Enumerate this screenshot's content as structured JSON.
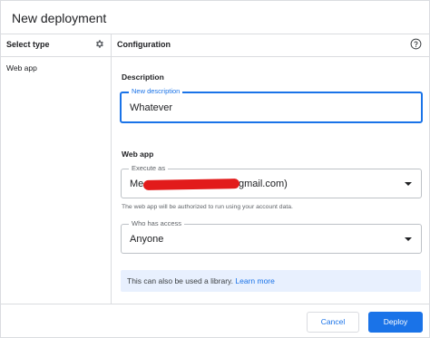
{
  "dialog": {
    "title": "New deployment",
    "sidebar": {
      "header": "Select type",
      "items": [
        {
          "label": "Web app"
        }
      ]
    },
    "config": {
      "header": "Configuration",
      "description_section": "Description",
      "description_field": {
        "label": "New description",
        "value": "Whatever"
      },
      "web_app_section": "Web app",
      "execute_as": {
        "label": "Execute as",
        "value_prefix": "Me",
        "value_suffix": "gmail.com)"
      },
      "execute_as_hint": "The web app will be authorized to run using your account data.",
      "access": {
        "label": "Who has access",
        "value": "Anyone"
      },
      "library_notice": {
        "text": "This can also be used a library.",
        "link": "Learn more"
      }
    },
    "footer": {
      "cancel_label": "Cancel",
      "deploy_label": "Deploy"
    }
  },
  "colors": {
    "accent": "#1a73e8",
    "border": "#dadce0",
    "info_bg": "#e8f0fe",
    "redaction": "#e21b1b"
  },
  "icons": {
    "settings": "gear-icon",
    "help": "help-circle-icon",
    "dropdown": "caret-down-icon"
  }
}
